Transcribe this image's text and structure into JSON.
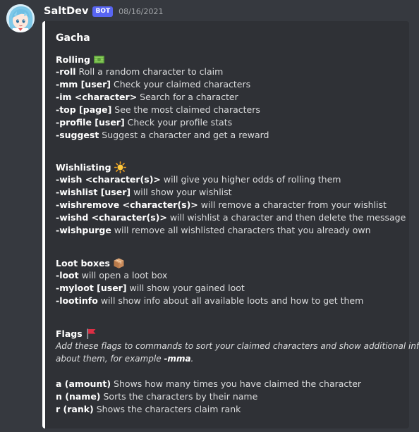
{
  "author": {
    "name": "SaltDev",
    "badge": "BOT",
    "timestamp": "08/16/2021",
    "avatar_icon": "anime-girl-avatar-icon"
  },
  "embed": {
    "accent_color": "#ffffff",
    "title": "Gacha",
    "fields": [
      {
        "key": "rolling",
        "name": "Rolling",
        "emoji": "money-bills-icon",
        "lines": [
          {
            "cmd": "-roll",
            "text": " Roll a random character to claim"
          },
          {
            "cmd": "-mm [user]",
            "text": " Check your claimed characters"
          },
          {
            "cmd": "-im <character>",
            "text": " Search for a character"
          },
          {
            "cmd": "-top [page]",
            "text": " See the most claimed characters"
          },
          {
            "cmd": "-profile [user]",
            "text": " Check your profile stats"
          },
          {
            "cmd": "-suggest",
            "text": " Suggest a character and get a reward"
          }
        ]
      },
      {
        "key": "wishlisting",
        "name": "Wishlisting",
        "emoji": "sun-icon",
        "lines": [
          {
            "cmd": "-wish <character(s)>",
            "text": " will give you higher odds of rolling them"
          },
          {
            "cmd": "-wishlist [user]",
            "text": " will show your wishlist"
          },
          {
            "cmd": "-wishremove <character(s)>",
            "text": " will remove a character from your wishlist"
          },
          {
            "cmd": "-wishd <character(s)>",
            "text": " will wishlist a character and then delete the message"
          },
          {
            "cmd": "-wishpurge",
            "text": " will remove all wishlisted characters that you already own"
          }
        ]
      },
      {
        "key": "loot_boxes",
        "name": "Loot boxes",
        "emoji": "package-icon",
        "lines": [
          {
            "cmd": "-loot",
            "text": " will open a loot box"
          },
          {
            "cmd": "-myloot [user]",
            "text": " will show your gained loot"
          },
          {
            "cmd": "-lootinfo",
            "text": " will show info about all available loots and how to get them"
          }
        ]
      },
      {
        "key": "flags",
        "name": "Flags",
        "emoji": "red-flag-icon",
        "description_line1": "Add these flags to commands to sort your claimed characters and show additional info",
        "description_line2_pre": "about them, for example ",
        "description_line2_cmd": "-mma",
        "description_line2_post": ".",
        "lines": [
          {
            "cmd": "a (amount)",
            "text": " Shows how many times you have claimed the character"
          },
          {
            "cmd": "n (name)",
            "text": " Sorts the characters by their name"
          },
          {
            "cmd": "r (rank)",
            "text": " Shows the characters claim rank"
          }
        ]
      }
    ]
  }
}
